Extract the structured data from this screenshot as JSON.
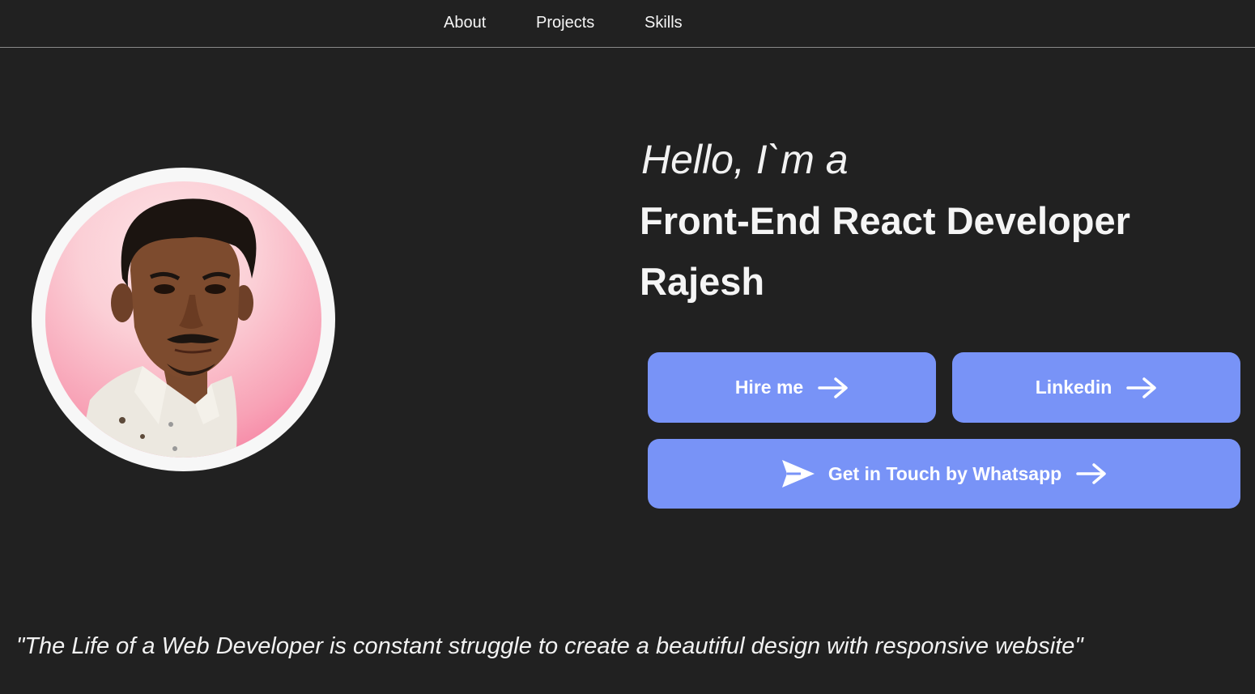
{
  "nav": {
    "items": [
      {
        "label": "About"
      },
      {
        "label": "Projects"
      },
      {
        "label": "Skills"
      }
    ]
  },
  "hero": {
    "greeting": "Hello, I`m a",
    "role": "Front-End React Developer",
    "name": "Rajesh",
    "avatar_icon": "profile-photo"
  },
  "buttons": {
    "hire_label": "Hire me",
    "linkedin_label": "Linkedin",
    "whatsapp_label": "Get in Touch by Whatsapp",
    "arrow_icon": "arrow-right-icon",
    "send_icon": "send-icon"
  },
  "quote": {
    "text": "\"The Life of a Web Developer is constant struggle to create a beautiful design with responsive website\""
  },
  "colors": {
    "background": "#212121",
    "button": "#7893f7",
    "text": "#f2f2f2"
  }
}
